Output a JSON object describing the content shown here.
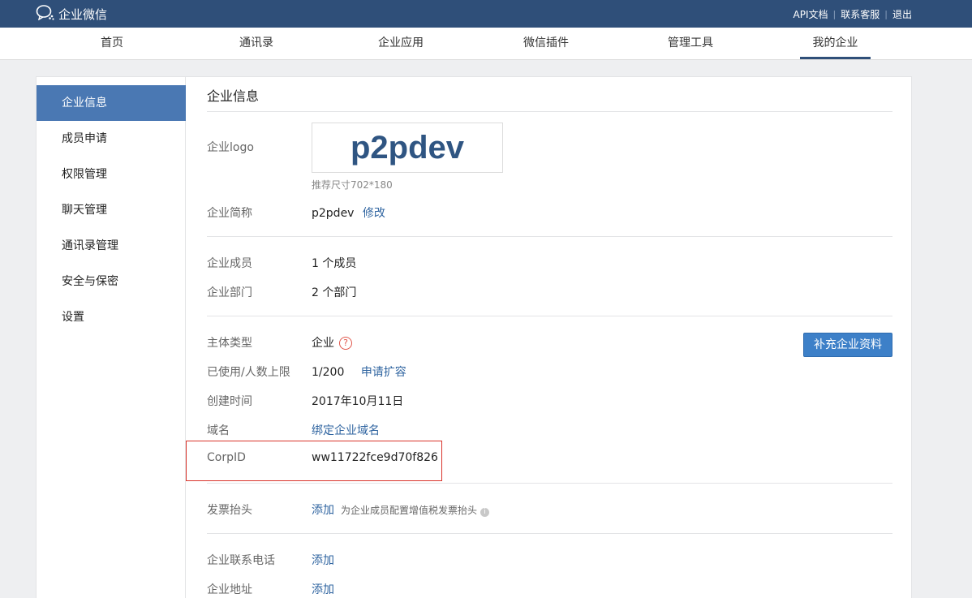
{
  "topbar": {
    "brand": "企业微信",
    "links": [
      "API文档",
      "联系客服",
      "退出"
    ],
    "separator": "|"
  },
  "nav": {
    "items": [
      "首页",
      "通讯录",
      "企业应用",
      "微信插件",
      "管理工具",
      "我的企业"
    ],
    "active": "我的企业"
  },
  "sidebar": {
    "items": [
      "企业信息",
      "成员申请",
      "权限管理",
      "聊天管理",
      "通讯录管理",
      "安全与保密",
      "设置"
    ],
    "active": "企业信息"
  },
  "content": {
    "title": "企业信息",
    "logo": {
      "label": "企业logo",
      "text": "p2pdev",
      "hint": "推荐尺寸702*180"
    },
    "short_name": {
      "label": "企业简称",
      "value": "p2pdev",
      "action": "修改"
    },
    "members": {
      "label": "企业成员",
      "value": "1 个成员"
    },
    "departments": {
      "label": "企业部门",
      "value": "2 个部门"
    },
    "entity_type": {
      "label": "主体类型",
      "value": "企业",
      "help": "?"
    },
    "usage": {
      "label": "已使用/人数上限",
      "value": "1/200",
      "action": "申请扩容"
    },
    "created": {
      "label": "创建时间",
      "value": "2017年10月11日"
    },
    "domain": {
      "label": "域名",
      "action": "绑定企业域名"
    },
    "corpid": {
      "label": "CorpID",
      "value": "ww11722fce9d70f826"
    },
    "invoice": {
      "label": "发票抬头",
      "action": "添加",
      "note": "为企业成员配置增值税发票抬头",
      "info": "i"
    },
    "phone": {
      "label": "企业联系电话",
      "action": "添加"
    },
    "address": {
      "label": "企业地址",
      "action": "添加"
    },
    "supplement_button": "补充企业资料"
  },
  "colors": {
    "topbar": "#2f4f79",
    "sidebar_active": "#4a78b3",
    "link": "#2f64a0",
    "button": "#3d80c8",
    "highlight_box": "#d9342b"
  }
}
